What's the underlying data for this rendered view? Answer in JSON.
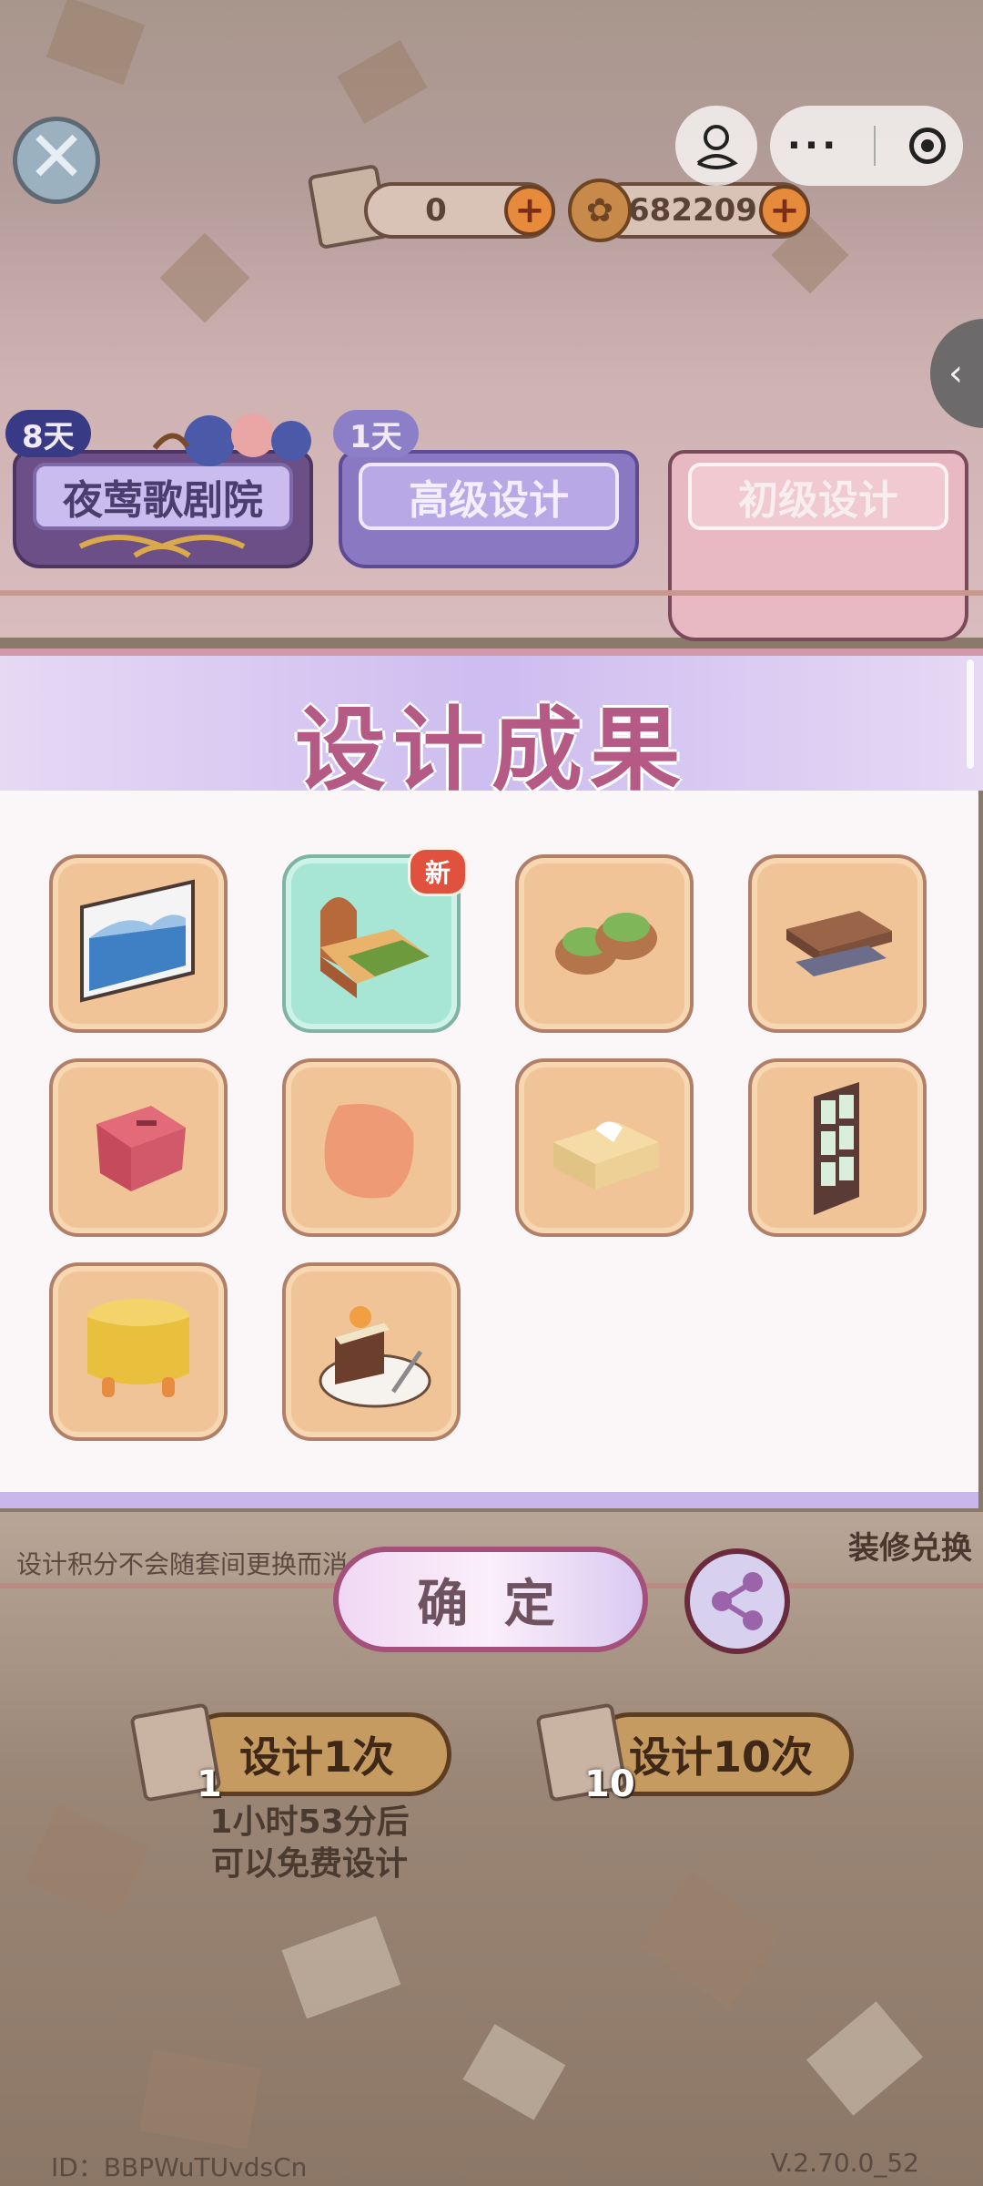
{
  "header": {
    "close_label": "close",
    "scrolls": "0",
    "coins": "682209"
  },
  "tabs": [
    {
      "label": "夜莺歌剧院",
      "badge": "8天"
    },
    {
      "label": "高级设计",
      "badge": "1天"
    },
    {
      "label": "初级设计",
      "badge": ""
    }
  ],
  "modal": {
    "title": "设计成果",
    "items": [
      {
        "name": "landscape-painting",
        "new": false
      },
      {
        "name": "green-bed",
        "new": true,
        "badge": "新"
      },
      {
        "name": "green-slippers",
        "new": false
      },
      {
        "name": "wooden-coffee-table",
        "new": false
      },
      {
        "name": "red-stool",
        "new": false
      },
      {
        "name": "orange-cushion",
        "new": false
      },
      {
        "name": "tissue-box",
        "new": false
      },
      {
        "name": "wooden-window",
        "new": false
      },
      {
        "name": "yellow-ottoman",
        "new": false
      },
      {
        "name": "cake-slice",
        "new": false
      }
    ]
  },
  "footer": {
    "hint": "设计积分不会随套间更换而消",
    "exchange": "装修兑换",
    "confirm": "确 定",
    "design_once": "设计1次",
    "design_once_cost": "1",
    "design_ten": "设计10次",
    "design_ten_cost": "10",
    "free_line1": "1小时53分后",
    "free_line2": "可以免费设计",
    "id": "ID：BBPWuTUvdsCn",
    "version": "V.2.70.0_52"
  },
  "colors": {
    "title": "#b55a84",
    "item_bg": "#f0c497",
    "special_item_bg": "#a7e6d5",
    "badge_red": "#e0523e"
  }
}
